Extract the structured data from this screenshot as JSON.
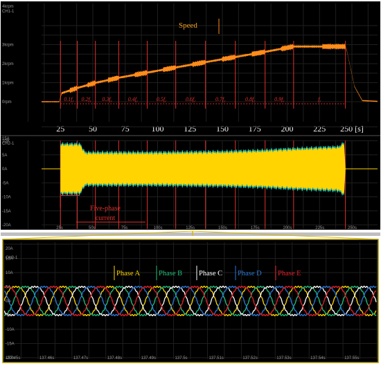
{
  "colors": {
    "background": "#000000",
    "grid": "#1f1f1f",
    "speed_trace": "#ff8c1a",
    "current_trace": "#ffd400",
    "marker": "#e0302c",
    "phase_a": "#ffd700",
    "phase_b": "#22c07a",
    "phase_c": "#ffffff",
    "phase_d": "#2a78d8",
    "phase_e": "#e8202a"
  },
  "chart_data": [
    {
      "type": "line",
      "title": "Speed",
      "channel": "CH1-1",
      "y_ticks": [
        "4krpm",
        "3krpm",
        "2krpm",
        "1krpm",
        "0rpm"
      ],
      "ylim": [
        0,
        4000
      ],
      "xlim": [
        0,
        275
      ],
      "x_ticks": [
        "25",
        "50",
        "75",
        "100",
        "125",
        "150",
        "175",
        "200",
        "225",
        "250 [s]"
      ],
      "segment_labels": [
        "0.1f_r",
        "0.2f_r",
        "0.3f_r",
        "0.4f_r",
        "0.5f_r",
        "0.6f_r",
        "0.7f_r",
        "0.8f_r",
        "0.9f_r",
        "f_r"
      ],
      "segment_boundaries": [
        25,
        38,
        52,
        70,
        92,
        114,
        137,
        160,
        183,
        205,
        245
      ],
      "series": [
        {
          "x": [
            0,
            24,
            26,
            38,
            52,
            70,
            92,
            114,
            137,
            160,
            183,
            205,
            245,
            246,
            252,
            258,
            275
          ],
          "y": [
            0,
            0,
            450,
            720,
            990,
            1260,
            1530,
            1800,
            2080,
            2350,
            2620,
            2900,
            2900,
            2700,
            800,
            60,
            0
          ]
        }
      ]
    },
    {
      "type": "area",
      "label": "Five-phase current",
      "channel": "CH2-1",
      "y_ticks": [
        "15A",
        "10A",
        "5A",
        "0A",
        "-5A",
        "-10A",
        "-15A",
        "-20A"
      ],
      "ylim": [
        -20,
        15
      ],
      "xlim": [
        0,
        275
      ],
      "x_ticks": [
        "25s",
        "50s",
        "75s",
        "100s",
        "125s",
        "150s",
        "175s",
        "200s",
        "225s",
        "250s"
      ],
      "series": [
        {
          "x": [
            0,
            24,
            25,
            40,
            44,
            60,
            100,
            150,
            180,
            205,
            240,
            244,
            245,
            275
          ],
          "amplitude": [
            0,
            0,
            8.5,
            8.5,
            5.5,
            5.5,
            5.5,
            5.8,
            6.2,
            6.8,
            7.5,
            9,
            0,
            0
          ]
        }
      ]
    },
    {
      "type": "line",
      "channel": "CH3-1",
      "y_ticks": [
        "20A",
        "15A",
        "10A",
        "5A",
        "0A",
        "-5A",
        "-10A",
        "-15A",
        "-20A"
      ],
      "ylim": [
        -20,
        20
      ],
      "xlim": [
        137.45,
        137.56
      ],
      "x_ticks": [
        "137.45s",
        "137.46s",
        "137.47s",
        "137.48s",
        "137.49s",
        "137.5s",
        "137.51s",
        "137.52s",
        "137.53s",
        "137.54s",
        "137.55s"
      ],
      "frequency_hz": 72,
      "amplitude_A": 5.5,
      "series": [
        {
          "name": "Phase A",
          "phase_deg": 0,
          "color": "#ffd700"
        },
        {
          "name": "Phase B",
          "phase_deg": -72,
          "color": "#22c07a"
        },
        {
          "name": "Phase C",
          "phase_deg": -144,
          "color": "#ffffff"
        },
        {
          "name": "Phase D",
          "phase_deg": -216,
          "color": "#2a78d8"
        },
        {
          "name": "Phase E",
          "phase_deg": -288,
          "color": "#e8202a"
        }
      ]
    }
  ]
}
